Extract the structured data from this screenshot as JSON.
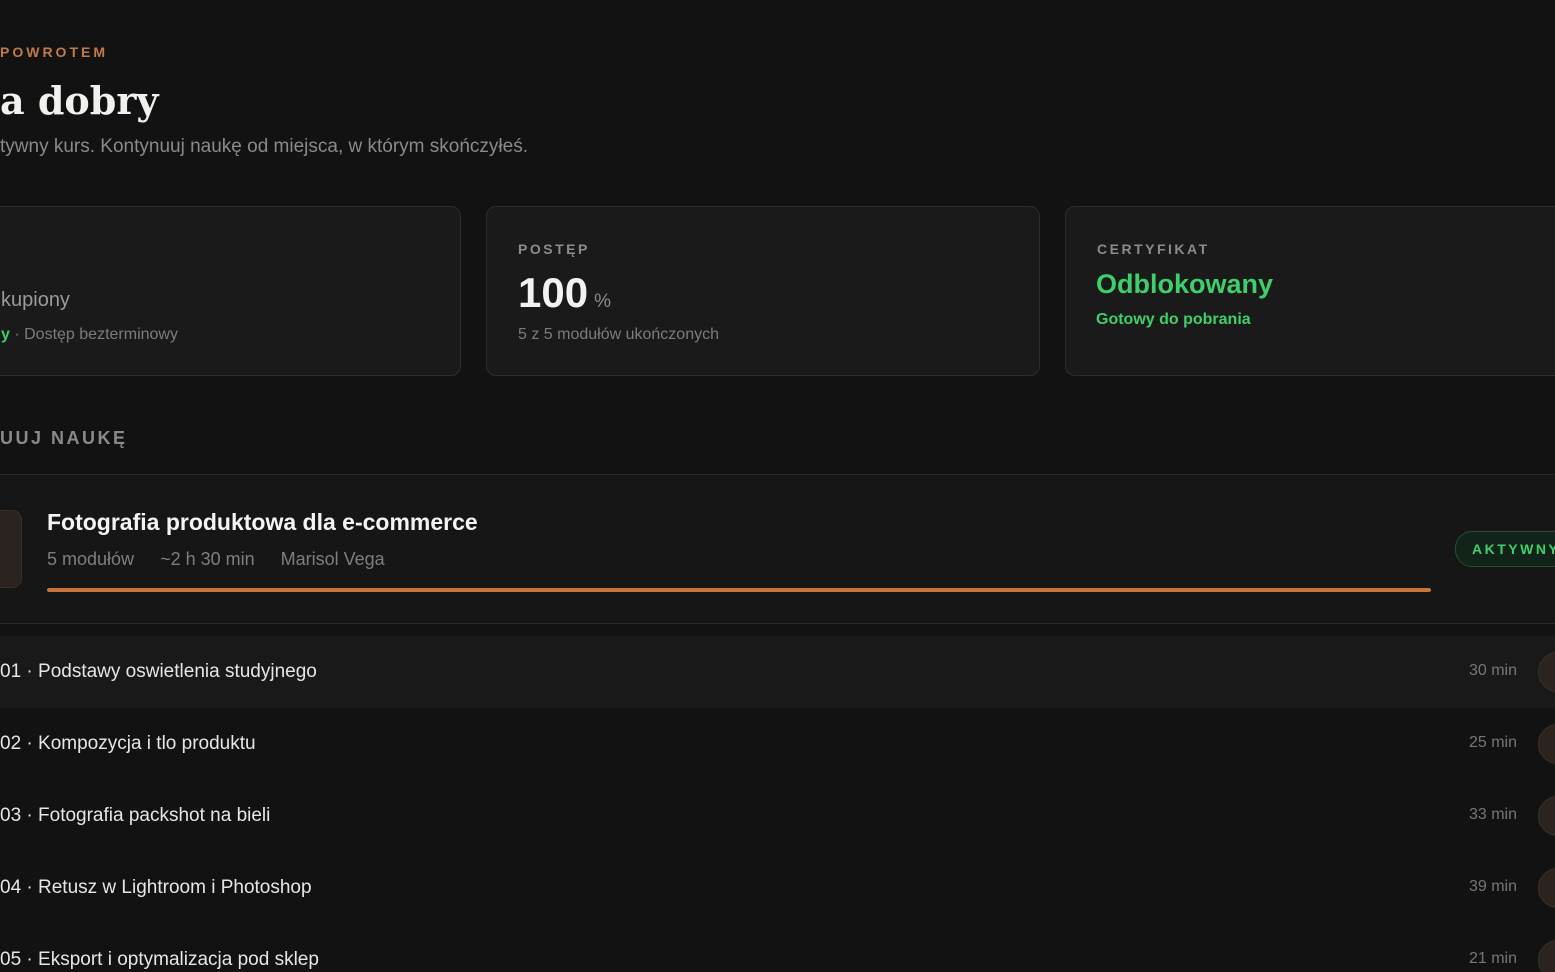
{
  "header": {
    "eyebrow": "POWROTEM",
    "title": "a dobry",
    "subtitle": "tywny kurs. Kontynuuj naukę od miejsca, w którym skończyłeś."
  },
  "stats": {
    "purchase": {
      "value": "kupiony",
      "status_highlight": "y",
      "status_rest": " · Dostęp bezterminowy"
    },
    "progress": {
      "label": "POSTĘP",
      "value": "100",
      "unit": "%",
      "sub": "5 z 5 modułów ukończonych"
    },
    "certificate": {
      "label": "CERTYFIKAT",
      "value": "Odblokowany",
      "sub": "Gotowy do pobrania"
    }
  },
  "continue_section": {
    "title": "UUJ NAUKĘ"
  },
  "course": {
    "title": "Fotografia produktowa dla e-commerce",
    "modules_count": "5 modułów",
    "duration": "~2 h 30 min",
    "instructor": "Marisol Vega",
    "progress_fraction": 1.0,
    "badge": "AKTYWNY"
  },
  "modules": [
    {
      "label": "01 · Podstawy oswietlenia studyjnego",
      "duration": "30 min"
    },
    {
      "label": "02 · Kompozycja i tlo produktu",
      "duration": "25 min"
    },
    {
      "label": "03 · Fotografia packshot na bieli",
      "duration": "33 min"
    },
    {
      "label": "04 · Retusz w Lightroom i Photoshop",
      "duration": "39 min"
    },
    {
      "label": "05 · Eksport i optymalizacja pod sklep",
      "duration": "21 min"
    }
  ],
  "colors": {
    "accent": "#c8733c",
    "success": "#3ecf6b",
    "background": "#121212",
    "card": "#1a1a1a"
  }
}
